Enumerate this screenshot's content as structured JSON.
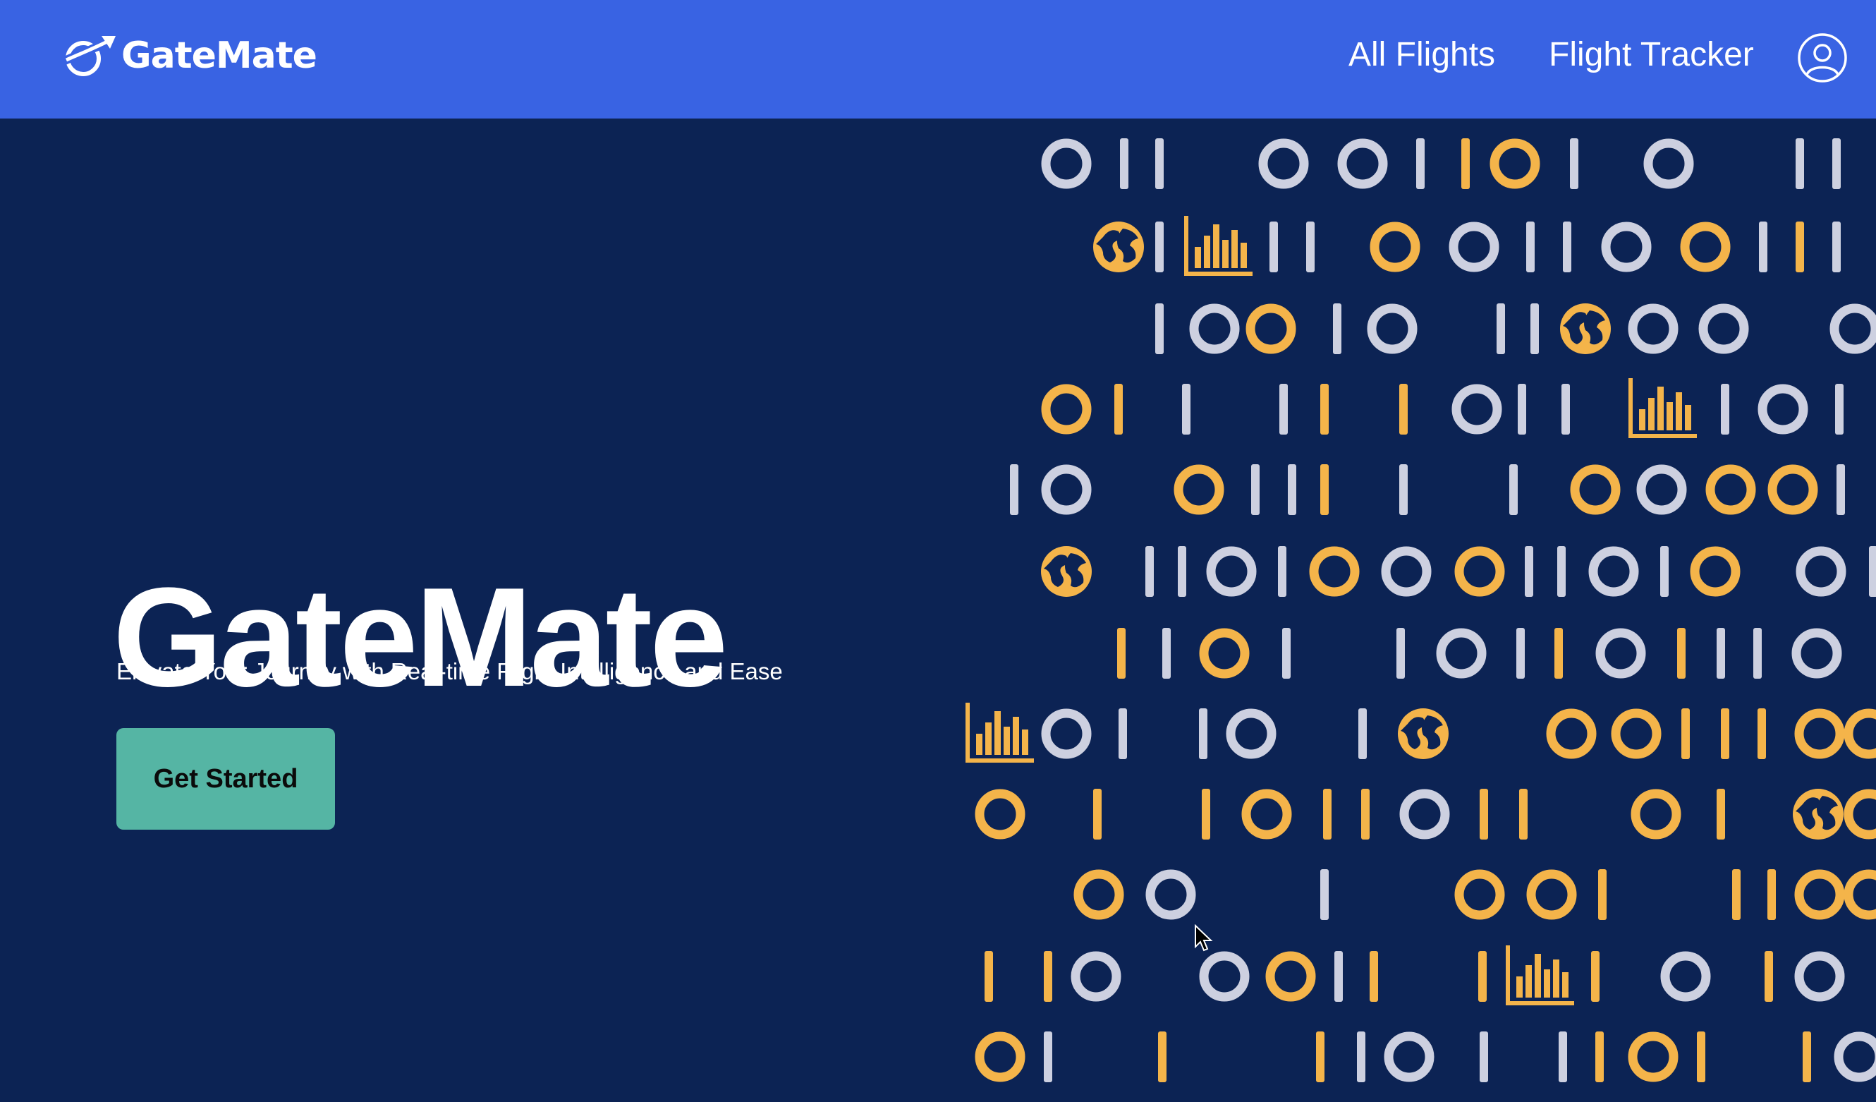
{
  "navbar": {
    "brand_name": "GateMate",
    "links": [
      {
        "label": "All Flights"
      },
      {
        "label": "Flight Tracker"
      }
    ],
    "profile_icon": "user-circle-icon",
    "logo_icon": "plane-globe-icon"
  },
  "hero": {
    "title": "GateMate",
    "subtitle": "Elevate Your Journey with Real-time Flight Intelligence and Ease",
    "cta_label": "Get Started"
  },
  "decor": {
    "icons": [
      "ring-icon",
      "bar-icon",
      "globe-icon",
      "bar-chart-icon"
    ]
  },
  "colors": {
    "navbar": "#3963e3",
    "background": "#0c2354",
    "cta": "#55b5a4",
    "accent_orange": "#f4b44a",
    "accent_gray": "#cdd0e0"
  }
}
